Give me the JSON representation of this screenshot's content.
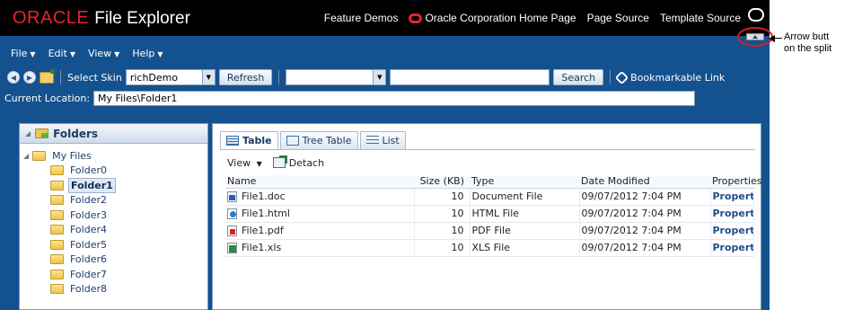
{
  "branding": {
    "logo": "ORACLE",
    "app_name": "File Explorer",
    "links": [
      "Feature Demos",
      "Oracle Corporation Home Page",
      "Page Source",
      "Template Source"
    ]
  },
  "menubar": {
    "items": [
      "File",
      "Edit",
      "View",
      "Help"
    ]
  },
  "toolbar": {
    "skin_label": "Select Skin",
    "skin_value": "richDemo",
    "refresh_label": "Refresh",
    "search_select_value": "",
    "search_value": "",
    "search_label": "Search",
    "bookmark_label": "Bookmarkable Link"
  },
  "location": {
    "label": "Current Location:",
    "value": "My Files\\Folder1"
  },
  "folders": {
    "header": "Folders",
    "root": "My Files",
    "children": [
      "Folder0",
      "Folder1",
      "Folder2",
      "Folder3",
      "Folder4",
      "Folder5",
      "Folder6",
      "Folder7",
      "Folder8"
    ],
    "selected": "Folder1"
  },
  "content": {
    "tabs": [
      "Table",
      "Tree Table",
      "List"
    ],
    "active_tab": "Table",
    "view_label": "View",
    "detach_label": "Detach",
    "columns": [
      "Name",
      "Size (KB)",
      "Type",
      "Date Modified",
      "Properties"
    ],
    "rows": [
      {
        "icon": "word-doc-icon",
        "name": "File1.doc",
        "size": "10",
        "type": "Document File",
        "date": "09/07/2012 7:04 PM",
        "properties": "Properties"
      },
      {
        "icon": "html-file-icon",
        "name": "File1.html",
        "size": "10",
        "type": "HTML File",
        "date": "09/07/2012 7:04 PM",
        "properties": "Properties"
      },
      {
        "icon": "pdf-file-icon",
        "name": "File1.pdf",
        "size": "10",
        "type": "PDF File",
        "date": "09/07/2012 7:04 PM",
        "properties": "Properties"
      },
      {
        "icon": "excel-file-icon",
        "name": "File1.xls",
        "size": "10",
        "type": "XLS File",
        "date": "09/07/2012 7:04 PM",
        "properties": "Properties"
      }
    ]
  },
  "annotation": {
    "line1": "Arrow butt",
    "line2": "on the split"
  },
  "colors": {
    "brand_red": "#e4252b",
    "chrome_blue": "#14518f",
    "callout_red": "#e11b22"
  }
}
